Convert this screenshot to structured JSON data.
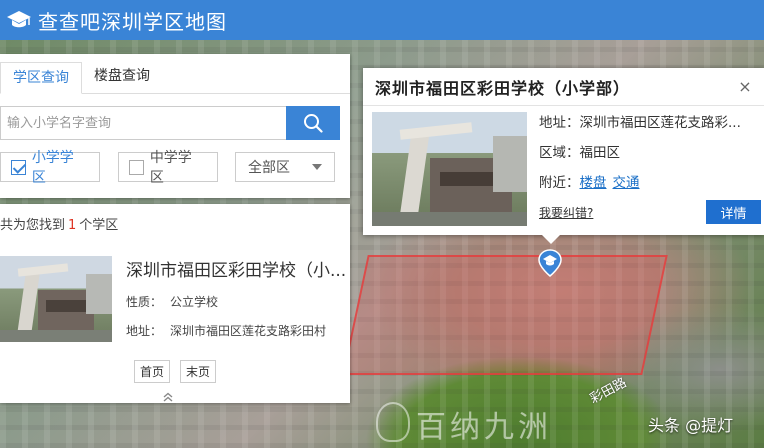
{
  "header": {
    "title": "查查吧深圳学区地图"
  },
  "panel": {
    "tabs": [
      {
        "label": "学区查询"
      },
      {
        "label": "楼盘查询"
      }
    ],
    "search_placeholder": "输入小学名字查询",
    "filters": {
      "primary_label": "小学学区",
      "primary_checked": true,
      "middle_label": "中学学区",
      "middle_checked": false,
      "district_value": "全部区"
    }
  },
  "results": {
    "count_prefix": "共为您找到",
    "count": "1",
    "count_suffix": "个学区",
    "items": [
      {
        "name": "深圳市福田区彩田学校（小...",
        "type_label": "性质：",
        "type": "公立学校",
        "address_label": "地址：",
        "address": "深圳市福田区莲花支路彩田村"
      }
    ],
    "pager": {
      "first": "首页",
      "last": "末页"
    }
  },
  "popup": {
    "title": "深圳市福田区彩田学校（小学部）",
    "close": "×",
    "address_label": "地址：",
    "address": "深圳市福田区莲花支路彩...",
    "region_label": "区域：",
    "region": "福田区",
    "nearby_label": "附近：",
    "nearby_links": [
      "楼盘",
      "交通"
    ],
    "report_link": "我要纠错?",
    "detail_button": "详情"
  },
  "map": {
    "watermark": "百纳九洲",
    "road_label": "彩田路",
    "credit": "头条 @提灯"
  },
  "colors": {
    "header_bg": "#3a84d6",
    "accent": "#3a84d6",
    "detail_button": "#1f6fcf",
    "count_highlight": "#dd3322"
  }
}
